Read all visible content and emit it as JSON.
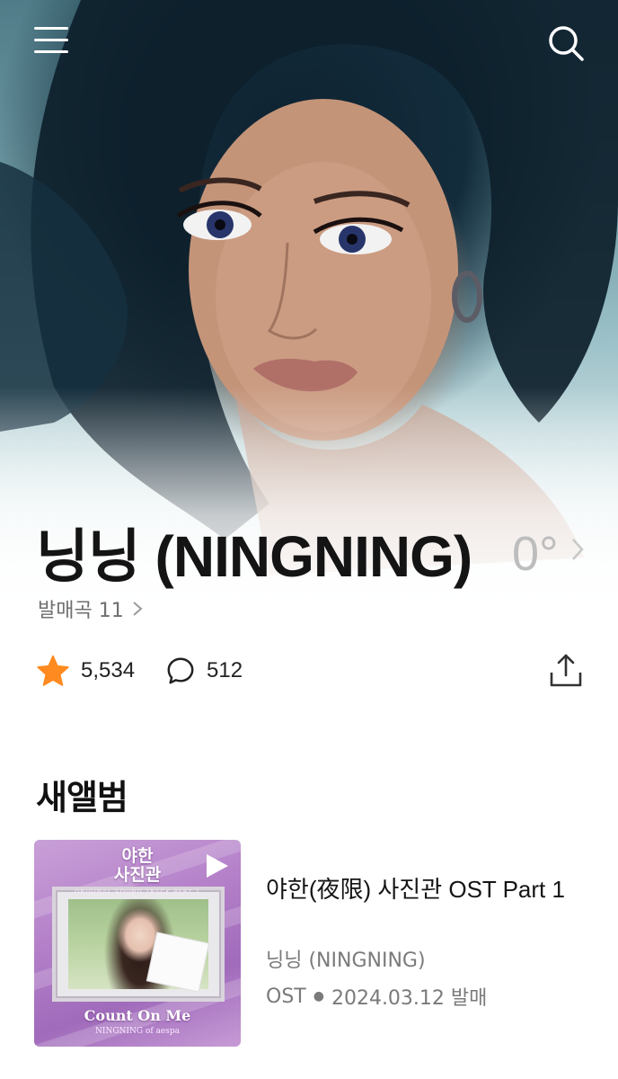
{
  "header": {
    "menu_icon": "hamburger-menu-icon",
    "search_icon": "search-icon"
  },
  "artist": {
    "name": "닝닝 (NINGNING)",
    "temperature": "0°",
    "release_label": "발매곡 11"
  },
  "stats": {
    "favorites": "5,534",
    "comments": "512",
    "favorite_icon": "star-icon",
    "comment_icon": "comment-bubble-icon",
    "share_icon": "share-icon"
  },
  "new_album": {
    "section_title": "새앨범",
    "title": "야한(夜限) 사진관 OST Part 1",
    "artist": "닝닝 (NINGNING)",
    "type": "OST",
    "release_date": "2024.03.12 발매",
    "cover": {
      "title_line1": "야한",
      "title_line2": "사진관",
      "subtitle": "ORIGINAL SOUND TRACK PART 1",
      "song": "Count On Me",
      "credit": "NINGNING of aespa"
    }
  },
  "colors": {
    "accent_star": "#ff8a1f",
    "text_primary": "#111111",
    "text_secondary": "#7a7a7a",
    "temperature": "#bdbdbd"
  }
}
